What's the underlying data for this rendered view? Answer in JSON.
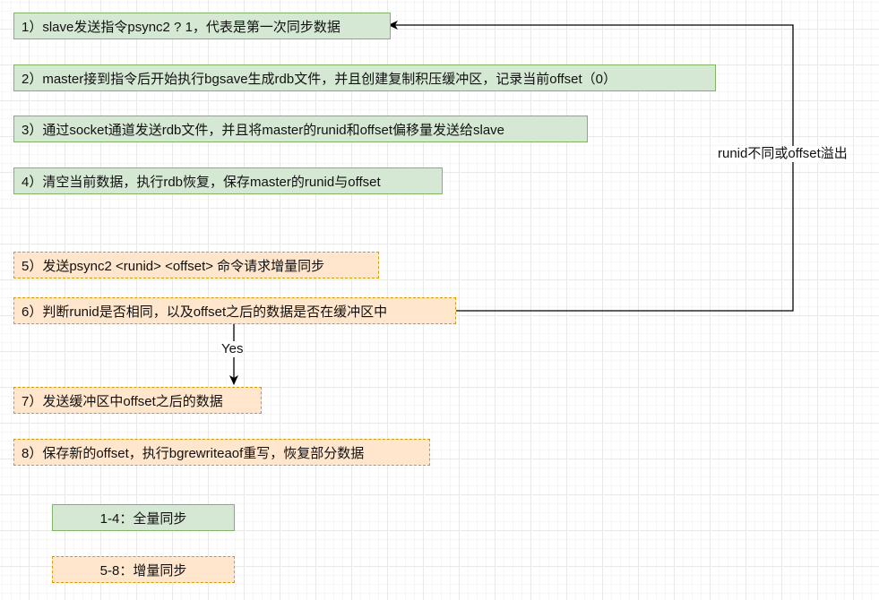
{
  "full_sync_steps": [
    "1）slave发送指令psync2 ? 1，代表是第一次同步数据",
    "2）master接到指令后开始执行bgsave生成rdb文件，并且创建复制积压缓冲区，记录当前offset（0）",
    "3）通过socket通道发送rdb文件，并且将master的runid和offset偏移量发送给slave",
    "4）清空当前数据，执行rdb恢复，保存master的runid与offset"
  ],
  "incremental_sync_steps": [
    "5）发送psync2 <runid> <offset> 命令请求增量同步",
    "6）判断runid是否相同，以及offset之后的数据是否在缓冲区中",
    "7）发送缓冲区中offset之后的数据",
    "8）保存新的offset，执行bgrewriteaof重写，恢复部分数据"
  ],
  "edges": {
    "yes_label": "Yes",
    "fallback_label": "runid不同或offset溢出"
  },
  "legend": {
    "full_label": "1-4：全量同步",
    "incr_label": "5-8：增量同步"
  },
  "colors": {
    "full_fill": "#d5e8d4",
    "full_border": "#82b366",
    "incr_fill": "#ffe6cc",
    "incr_border": "#d79b00",
    "edge": "#000000"
  }
}
